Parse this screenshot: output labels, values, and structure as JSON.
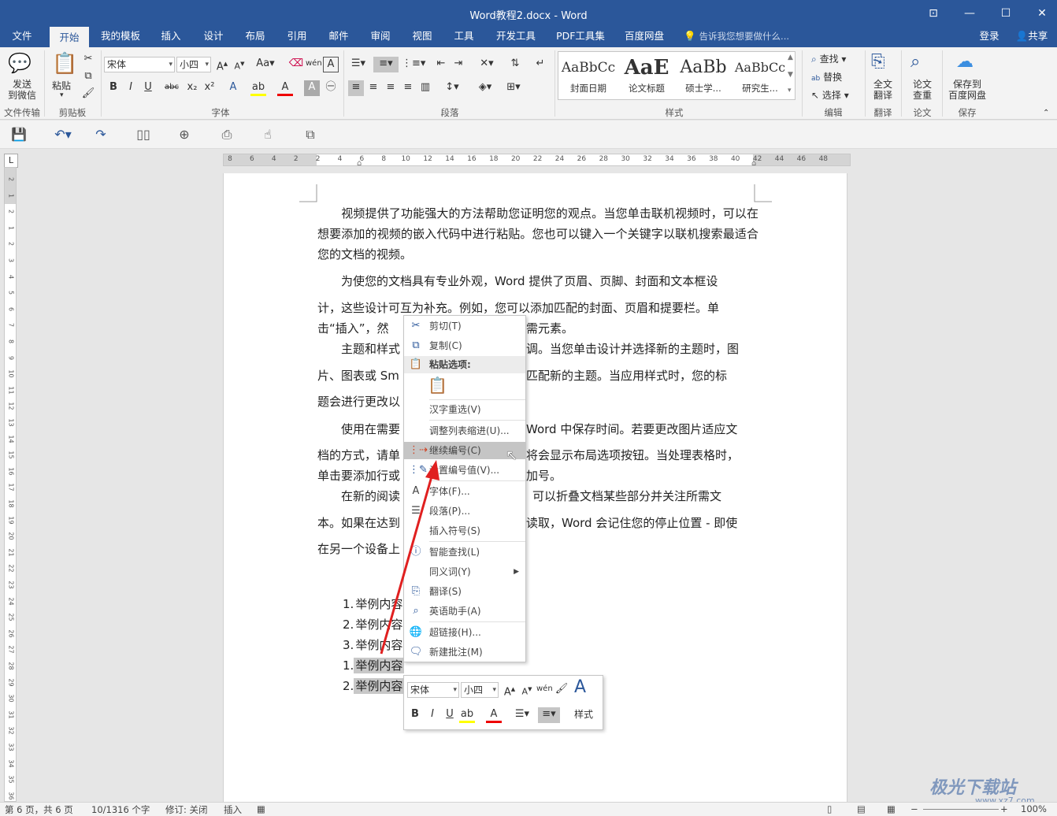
{
  "title": "Word教程2.docx - Word",
  "tabs": [
    "文件",
    "开始",
    "我的模板",
    "插入",
    "设计",
    "布局",
    "引用",
    "邮件",
    "审阅",
    "视图",
    "工具",
    "开发工具",
    "PDF工具集",
    "百度网盘"
  ],
  "tell_me": "告诉我您想要做什么...",
  "login": "登录",
  "share": "共享",
  "ribbon": {
    "send_wechat": "发送\n到微信",
    "paste": "粘贴",
    "font_name": "宋体",
    "font_size": "小四",
    "groups": [
      "文件传输",
      "剪贴板",
      "字体",
      "段落",
      "样式",
      "编辑",
      "翻译",
      "论文",
      "保存"
    ],
    "styles": [
      {
        "sample": "AaBbCc",
        "label": "封面日期"
      },
      {
        "sample": "AaE",
        "label": "论文标题"
      },
      {
        "sample": "AaBb",
        "label": "硕士学..."
      },
      {
        "sample": "AaBbCc",
        "label": "研究生..."
      }
    ],
    "find": "查找",
    "replace": "替换",
    "select": "选择",
    "full_translate": "全文\n翻译",
    "paper_check": "论文\n查重",
    "save_baidu": "保存到\n百度网盘"
  },
  "ruler_h": [
    "8",
    "6",
    "4",
    "2",
    "2",
    "4",
    "6",
    "8",
    "10",
    "12",
    "14",
    "16",
    "18",
    "20",
    "22",
    "24",
    "26",
    "28",
    "30",
    "32",
    "34",
    "36",
    "38",
    "40",
    "42",
    "44",
    "46",
    "48"
  ],
  "ruler_v": [
    "2",
    "1",
    "2",
    "1",
    "2",
    "3",
    "4",
    "5",
    "6",
    "7",
    "8",
    "9",
    "10",
    "11",
    "12",
    "13",
    "14",
    "15",
    "16",
    "17",
    "18",
    "19",
    "20",
    "21",
    "22",
    "23",
    "24",
    "25",
    "26",
    "27",
    "28",
    "29",
    "30",
    "31",
    "32",
    "33",
    "34",
    "35",
    "36"
  ],
  "doc": {
    "p1": "　　视频提供了功能强大的方法帮助您证明您的观点。当您单击联机视频时，可以在想要添加的视频的嵌入代码中进行粘贴。您也可以键入一个关键字以联机搜索最适合您的文档的视频。",
    "p2a": "　　为使您的文档具有专业外观，Word 提供了页眉、页脚、封面和文本框设",
    "p2b": "计，这些设计可互为补充。例如，您可以添加匹配的封面、页眉和提要栏。单",
    "p2c": "击“插入”，然",
    "p2c_tail": "需元素。",
    "p3a": "　　主题和样式",
    "p3a_tail": "调。当您单击设计并选择新的主题时，图",
    "p3b": "片、图表或 Sm",
    "p3b_tail": "匹配新的主题。当应用样式时，您的标",
    "p3c": "题会进行更改以",
    "p4a": "　　使用在需要",
    "p4a_tail": "Word 中保存时间。若要更改图片适应文",
    "p4b": "档的方式，请单",
    "p4b_tail": "将会显示布局选项按钮。当处理表格时，",
    "p4c": "单击要添加行或",
    "p4c_tail": "加号。",
    "p5a": "　　在新的阅读",
    "p5a_tail": "可以折叠文档某些部分并关注所需文",
    "p5b": "本。如果在达到",
    "p5b_tail": "读取，Word 会记住您的停止位置 - 即使",
    "p5c": "在另一个设备上",
    "list": [
      {
        "num": "1.",
        "text": "举例内容"
      },
      {
        "num": "2.",
        "text": "举例内容"
      },
      {
        "num": "3.",
        "text": "举例内容"
      },
      {
        "num": "1.",
        "text": "举例内容"
      },
      {
        "num": "2.",
        "text": "举例内容"
      }
    ]
  },
  "context_menu": [
    {
      "label": "剪切(T)",
      "icon": "scissors-icon"
    },
    {
      "label": "复制(C)",
      "icon": "copy-icon"
    },
    {
      "label": "粘贴选项:",
      "icon": "paste-icon"
    },
    {
      "label": "汉字重选(V)",
      "icon": ""
    },
    {
      "label": "调整列表缩进(U)...",
      "icon": ""
    },
    {
      "label": "继续编号(C)",
      "icon": "continue-numbering-icon"
    },
    {
      "label": "设置编号值(V)...",
      "icon": "set-numbering-icon"
    },
    {
      "label": "字体(F)...",
      "icon": "font-icon"
    },
    {
      "label": "段落(P)...",
      "icon": "paragraph-icon"
    },
    {
      "label": "插入符号(S)",
      "icon": ""
    },
    {
      "label": "智能查找(L)",
      "icon": "smart-lookup-icon"
    },
    {
      "label": "同义词(Y)",
      "icon": ""
    },
    {
      "label": "翻译(S)",
      "icon": "translate-icon"
    },
    {
      "label": "英语助手(A)",
      "icon": "english-assistant-icon"
    },
    {
      "label": "超链接(H)...",
      "icon": "hyperlink-icon"
    },
    {
      "label": "新建批注(M)",
      "icon": "comment-icon"
    }
  ],
  "mini_toolbar": {
    "font": "宋体",
    "size": "小四",
    "styles": "样式"
  },
  "status": {
    "page": "第 6 页，共 6 页",
    "words": "10/1316 个字",
    "track": "修订: 关闭",
    "mode": "插入",
    "zoom": "100%"
  },
  "watermark": "极光下载站",
  "watermark_url": "www.xz7.com",
  "colors": {
    "accent": "#2b579a",
    "arrow": "#e02020"
  }
}
